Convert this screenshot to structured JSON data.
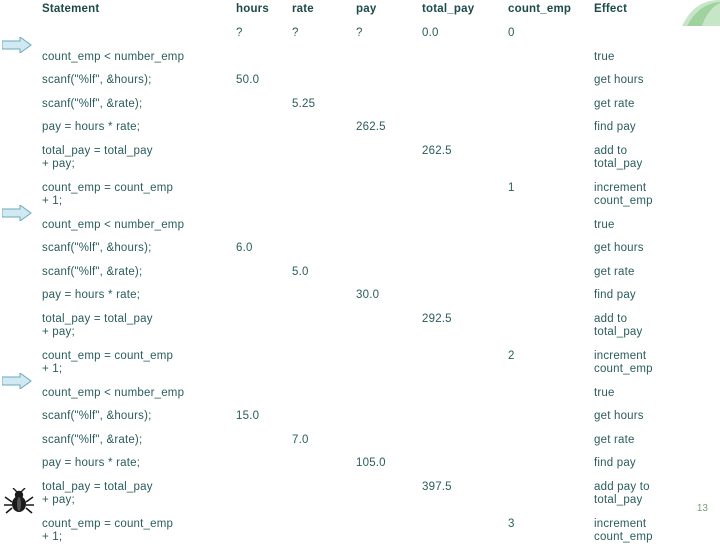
{
  "slide": {
    "page_number": "13",
    "accent_color": "#2b5c5c",
    "header_color": "#1d4a4a",
    "arrow_color": "#bfe3ea"
  },
  "table": {
    "columns": [
      "Statement",
      "hours",
      "rate",
      "pay",
      "total_pay",
      "count_emp",
      "Effect"
    ],
    "rows": [
      {
        "statement": "",
        "hours": "?",
        "rate": "?",
        "pay": "?",
        "total_pay": "0.0",
        "count_emp": "0",
        "effect": "",
        "arrow": false
      },
      {
        "statement": "count_emp < number_emp",
        "hours": "",
        "rate": "",
        "pay": "",
        "total_pay": "",
        "count_emp": "",
        "effect": "true",
        "arrow": true
      },
      {
        "statement": "scanf(\"%lf\", &hours);",
        "hours": "50.0",
        "rate": "",
        "pay": "",
        "total_pay": "",
        "count_emp": "",
        "effect": "get hours",
        "arrow": false
      },
      {
        "statement": "scanf(\"%lf\", &rate);",
        "hours": "",
        "rate": "5.25",
        "pay": "",
        "total_pay": "",
        "count_emp": "",
        "effect": "get rate",
        "arrow": false
      },
      {
        "statement": "pay = hours * rate;",
        "hours": "",
        "rate": "",
        "pay": "262.5",
        "total_pay": "",
        "count_emp": "",
        "effect": "find pay",
        "arrow": false
      },
      {
        "statement": "total_pay = total_pay\n          + pay;",
        "hours": "",
        "rate": "",
        "pay": "",
        "total_pay": "262.5",
        "count_emp": "",
        "effect": "add to\ntotal_pay",
        "arrow": false
      },
      {
        "statement": "count_emp = count_emp\n          + 1;",
        "hours": "",
        "rate": "",
        "pay": "",
        "total_pay": "",
        "count_emp": "1",
        "effect": "increment\ncount_emp",
        "arrow": false
      },
      {
        "statement": "count_emp < number_emp",
        "hours": "",
        "rate": "",
        "pay": "",
        "total_pay": "",
        "count_emp": "",
        "effect": "true",
        "arrow": true
      },
      {
        "statement": "scanf(\"%lf\", &hours);",
        "hours": "6.0",
        "rate": "",
        "pay": "",
        "total_pay": "",
        "count_emp": "",
        "effect": "get hours",
        "arrow": false
      },
      {
        "statement": "scanf(\"%lf\", &rate);",
        "hours": "",
        "rate": "5.0",
        "pay": "",
        "total_pay": "",
        "count_emp": "",
        "effect": "get rate",
        "arrow": false
      },
      {
        "statement": "pay = hours * rate;",
        "hours": "",
        "rate": "",
        "pay": "30.0",
        "total_pay": "",
        "count_emp": "",
        "effect": "find pay",
        "arrow": false
      },
      {
        "statement": "total_pay = total_pay\n          + pay;",
        "hours": "",
        "rate": "",
        "pay": "",
        "total_pay": "292.5",
        "count_emp": "",
        "effect": "add to\ntotal_pay",
        "arrow": false
      },
      {
        "statement": "count_emp = count_emp\n          + 1;",
        "hours": "",
        "rate": "",
        "pay": "",
        "total_pay": "",
        "count_emp": "2",
        "effect": "increment\ncount_emp",
        "arrow": false
      },
      {
        "statement": "count_emp < number_emp",
        "hours": "",
        "rate": "",
        "pay": "",
        "total_pay": "",
        "count_emp": "",
        "effect": "true",
        "arrow": true
      },
      {
        "statement": "scanf(\"%lf\", &hours);",
        "hours": "15.0",
        "rate": "",
        "pay": "",
        "total_pay": "",
        "count_emp": "",
        "effect": "get hours",
        "arrow": false
      },
      {
        "statement": "scanf(\"%lf\", &rate);",
        "hours": "",
        "rate": "7.0",
        "pay": "",
        "total_pay": "",
        "count_emp": "",
        "effect": "get rate",
        "arrow": false
      },
      {
        "statement": "pay = hours * rate;",
        "hours": "",
        "rate": "",
        "pay": "105.0",
        "total_pay": "",
        "count_emp": "",
        "effect": "find pay",
        "arrow": false
      },
      {
        "statement": "total_pay = total_pay\n          + pay;",
        "hours": "",
        "rate": "",
        "pay": "",
        "total_pay": "397.5",
        "count_emp": "",
        "effect": "add pay to\ntotal_pay",
        "arrow": false
      },
      {
        "statement": "count_emp = count_emp\n          + 1;",
        "hours": "",
        "rate": "",
        "pay": "",
        "total_pay": "",
        "count_emp": "3",
        "effect": "increment\ncount_emp",
        "arrow": false
      }
    ]
  }
}
